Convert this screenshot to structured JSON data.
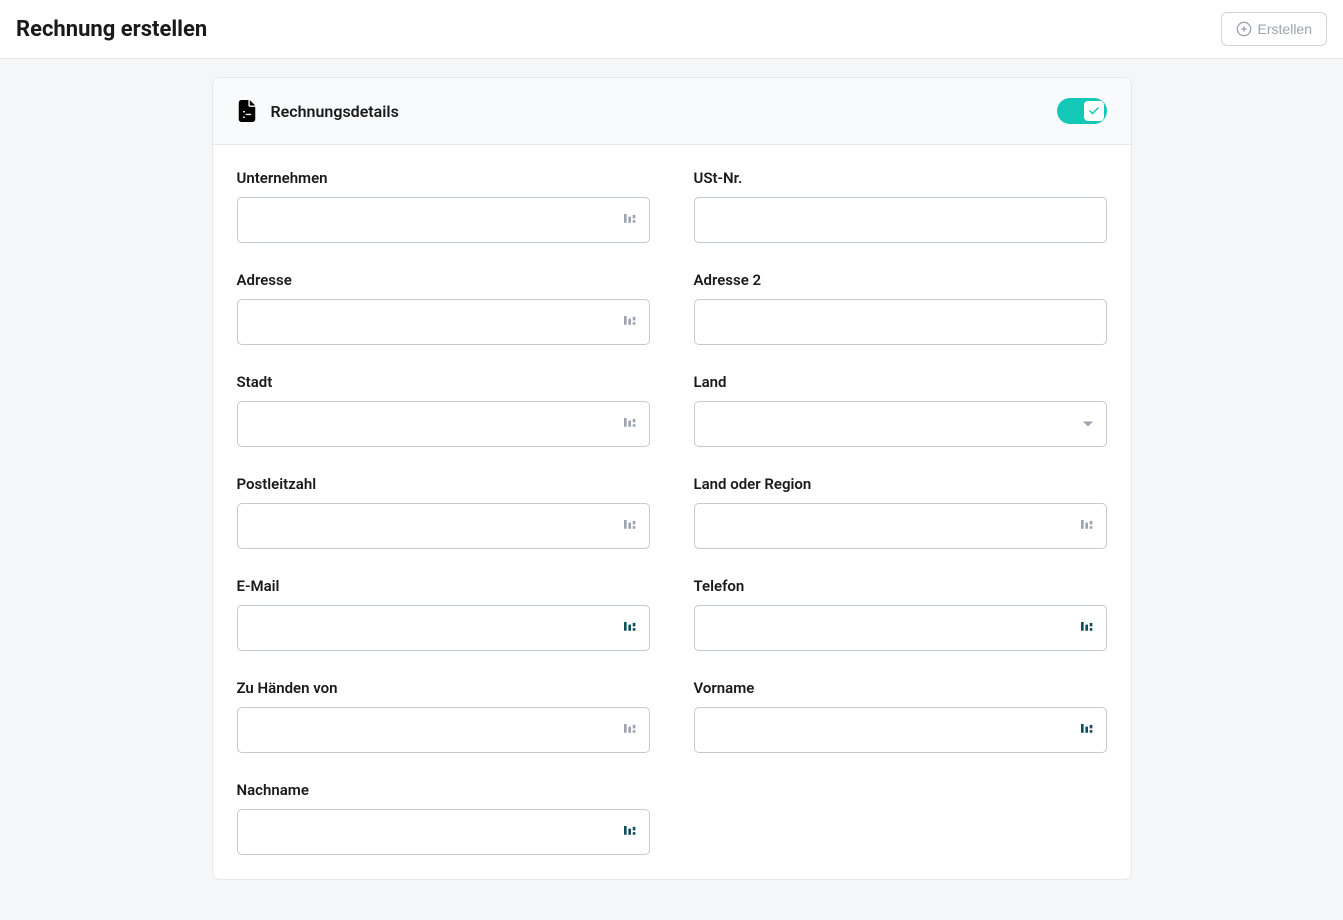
{
  "header": {
    "title": "Rechnung erstellen",
    "create_button": "Erstellen"
  },
  "section": {
    "title": "Rechnungsdetails",
    "toggle_on": true
  },
  "fields": {
    "company": {
      "label": "Unternehmen",
      "value": ""
    },
    "vat": {
      "label": "USt-Nr.",
      "value": ""
    },
    "address": {
      "label": "Adresse",
      "value": ""
    },
    "address2": {
      "label": "Adresse 2",
      "value": ""
    },
    "city": {
      "label": "Stadt",
      "value": ""
    },
    "country": {
      "label": "Land",
      "value": ""
    },
    "postal": {
      "label": "Postleitzahl",
      "value": ""
    },
    "region": {
      "label": "Land oder Region",
      "value": ""
    },
    "email": {
      "label": "E-Mail",
      "value": ""
    },
    "phone": {
      "label": "Telefon",
      "value": ""
    },
    "attention": {
      "label": "Zu Händen von",
      "value": ""
    },
    "firstname": {
      "label": "Vorname",
      "value": ""
    },
    "lastname": {
      "label": "Nachname",
      "value": ""
    }
  }
}
